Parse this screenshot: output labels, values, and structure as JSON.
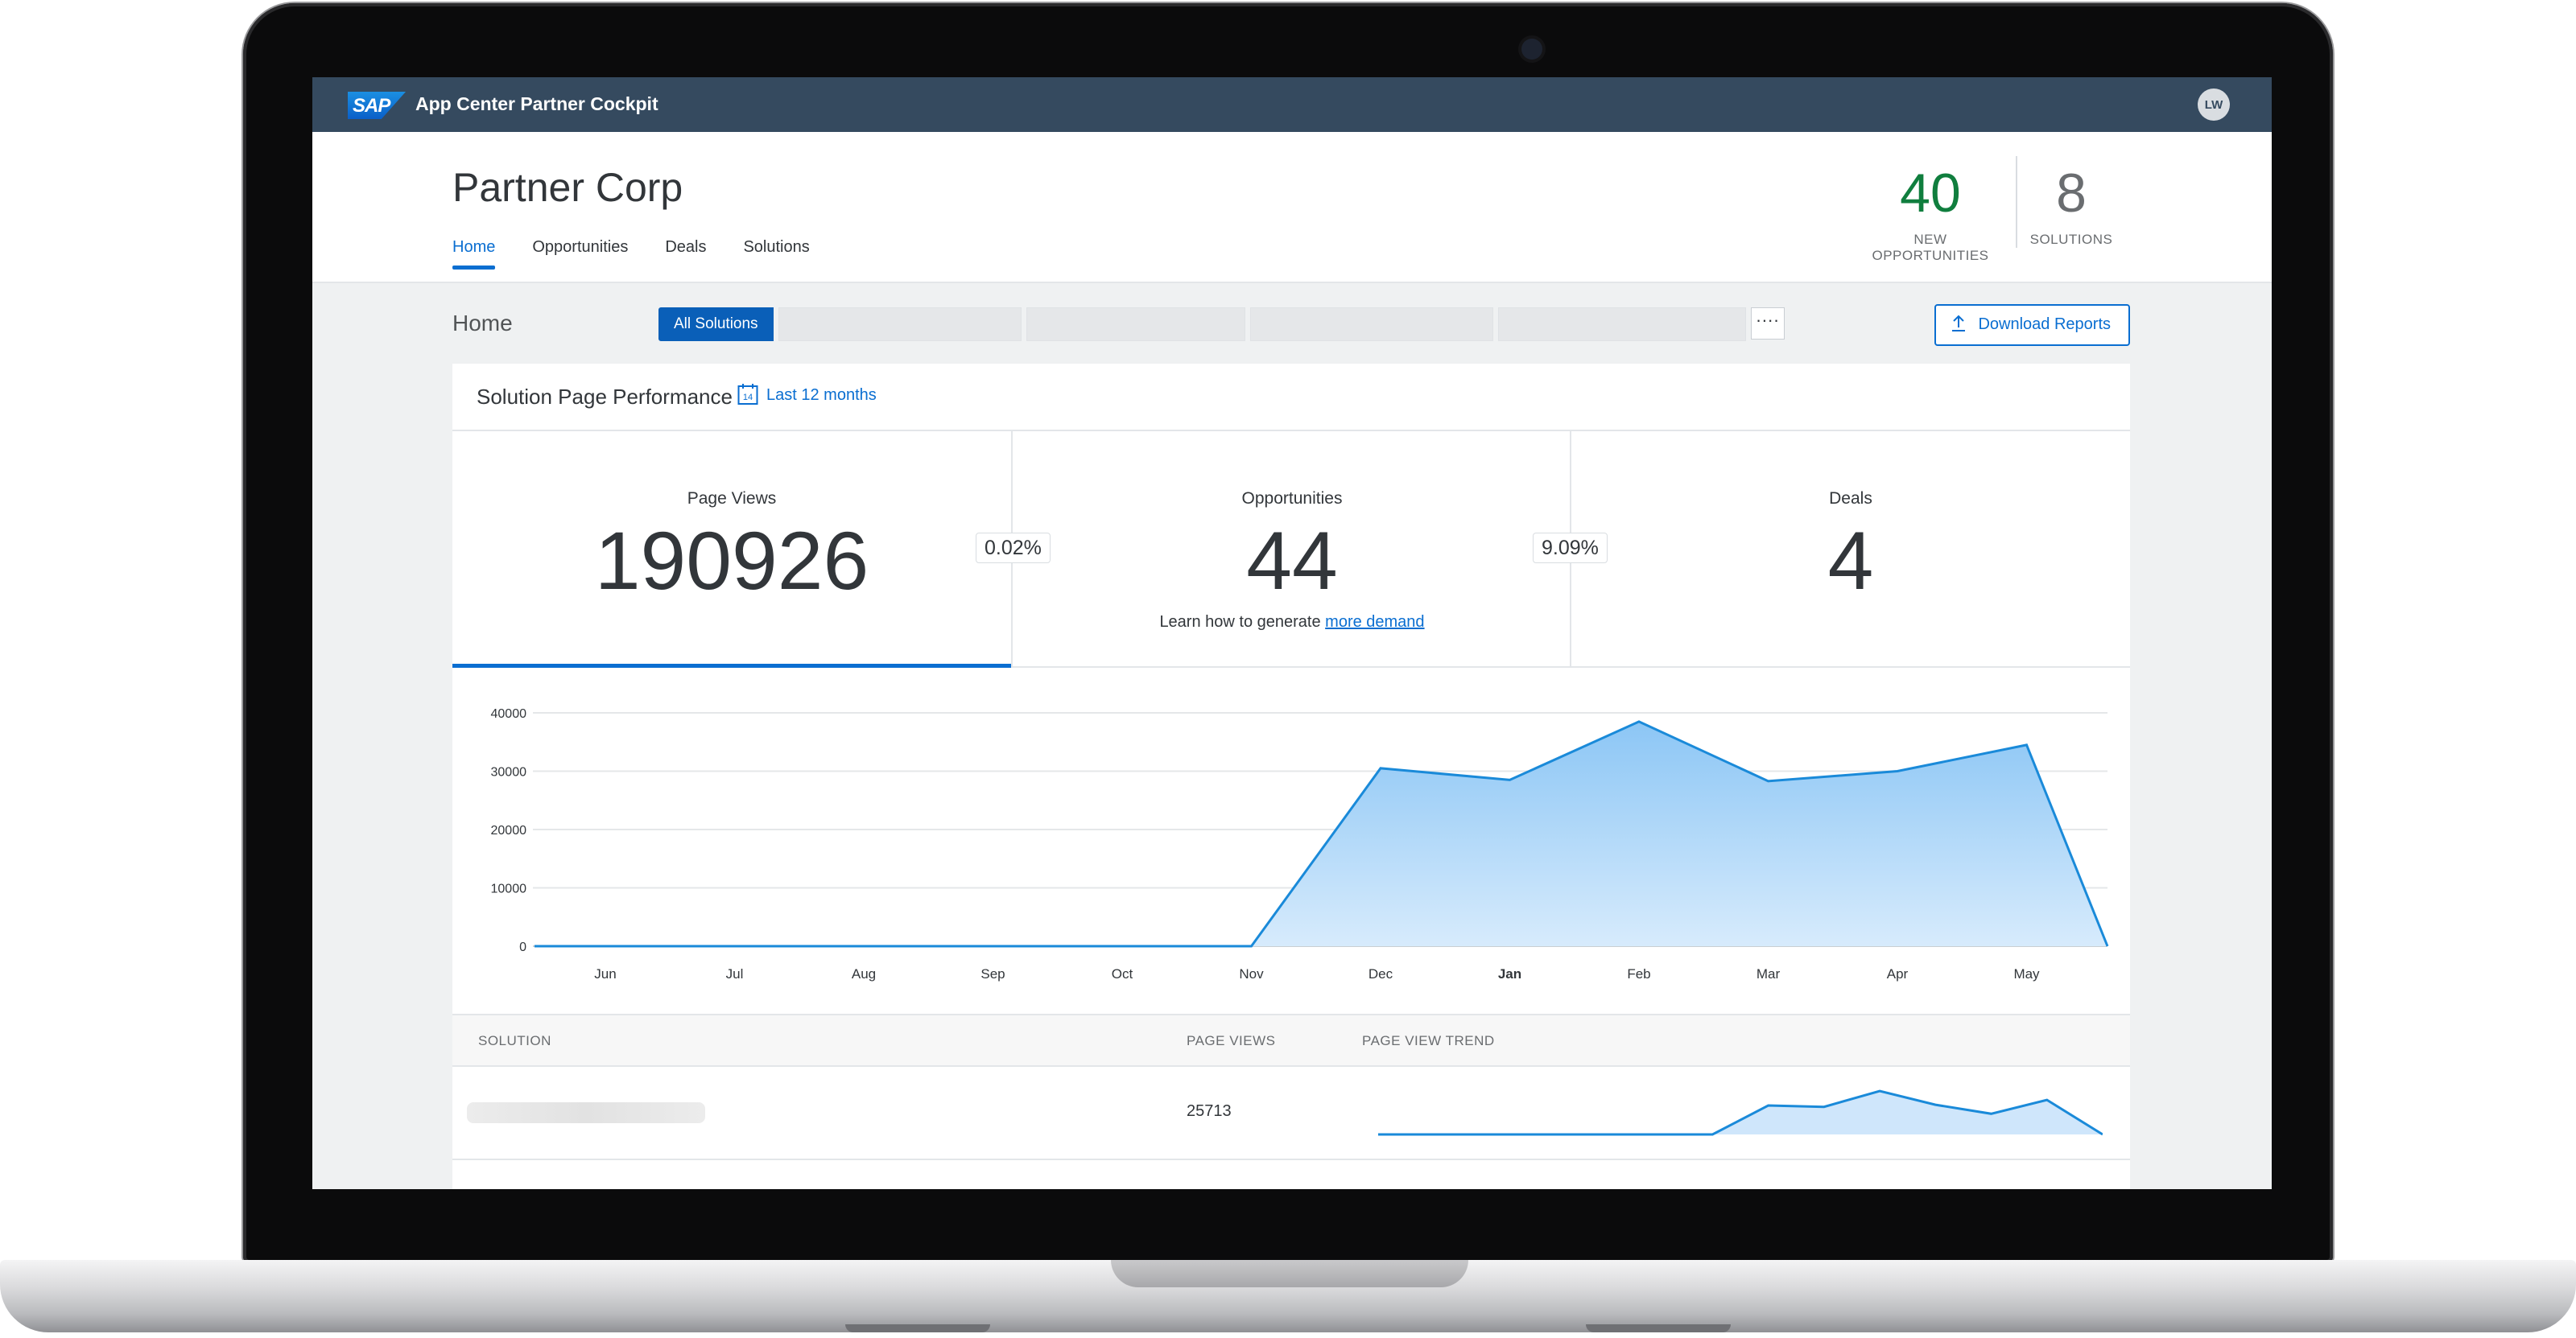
{
  "shell": {
    "logo": "SAP",
    "title": "App Center Partner Cockpit",
    "avatar_initials": "LW"
  },
  "header": {
    "company": "Partner Corp",
    "tabs": [
      "Home",
      "Opportunities",
      "Deals",
      "Solutions"
    ],
    "kpis": [
      {
        "value": "40",
        "label": "NEW OPPORTUNITIES",
        "color": "#107e3e"
      },
      {
        "value": "8",
        "label": "SOLUTIONS",
        "color": "#6a6d70"
      }
    ]
  },
  "subbar": {
    "title": "Home",
    "filter_active": "All Solutions",
    "more": "····",
    "download_label": "Download Reports"
  },
  "card": {
    "title": "Solution Page Performance",
    "period_icon_text": "14",
    "period": "Last 12 months",
    "metrics": [
      {
        "label": "Page Views",
        "value": "190926"
      },
      {
        "label": "Opportunities",
        "value": "44",
        "note_prefix": "Learn how to generate",
        "note_link": "more demand"
      },
      {
        "label": "Deals",
        "value": "4"
      }
    ],
    "conversions": [
      "0.02%",
      "9.09%"
    ]
  },
  "table": {
    "headers": [
      "SOLUTION",
      "PAGE VIEWS",
      "PAGE VIEW TREND"
    ],
    "rows": [
      {
        "page_views": "25713"
      }
    ]
  },
  "chart_data": {
    "type": "area",
    "x": [
      "Jun",
      "Jul",
      "Aug",
      "Sep",
      "Oct",
      "Nov",
      "Dec",
      "Jan",
      "Feb",
      "Mar",
      "Apr",
      "May"
    ],
    "values": [
      0,
      0,
      0,
      0,
      0,
      0,
      30500,
      28500,
      38500,
      28300,
      30000,
      34500,
      0
    ],
    "yticks": [
      0,
      10000,
      20000,
      30000,
      40000
    ],
    "ylim": [
      0,
      40000
    ],
    "bold_tick": "Jan",
    "color": "#1a8ad9",
    "grid": true
  },
  "sparkline": {
    "values": [
      0,
      0,
      0,
      0,
      0,
      0,
      0,
      4200,
      4000,
      6300,
      4300,
      3000,
      5000,
      0
    ]
  }
}
